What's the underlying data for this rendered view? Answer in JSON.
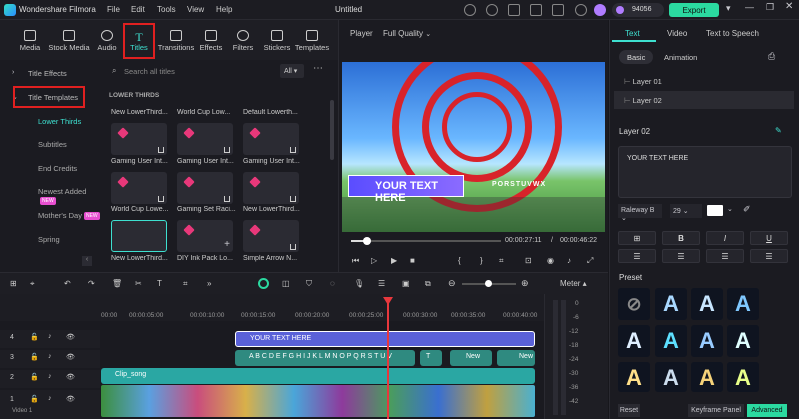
{
  "titlebar": {
    "app_name": "Wondershare Filmora",
    "menus": [
      "File",
      "Edit",
      "Tools",
      "View",
      "Help"
    ],
    "project_name": "Untitled",
    "credits": "94056",
    "export_label": "Export"
  },
  "media_tabs": [
    {
      "label": "Media",
      "icon": "media-icon"
    },
    {
      "label": "Stock Media",
      "icon": "stock-media-icon"
    },
    {
      "label": "Audio",
      "icon": "audio-icon"
    },
    {
      "label": "Titles",
      "icon": "titles-icon",
      "active": true
    },
    {
      "label": "Transitions",
      "icon": "transitions-icon"
    },
    {
      "label": "Effects",
      "icon": "effects-icon"
    },
    {
      "label": "Filters",
      "icon": "filters-icon"
    },
    {
      "label": "Stickers",
      "icon": "stickers-icon"
    },
    {
      "label": "Templates",
      "icon": "templates-icon"
    }
  ],
  "sidenav": {
    "items": [
      {
        "label": "Title Effects"
      },
      {
        "label": "Title Templates"
      }
    ],
    "subitems": [
      {
        "label": "Lower Thirds",
        "selected": true
      },
      {
        "label": "Subtitles"
      },
      {
        "label": "End Credits"
      },
      {
        "label": "Newest Added",
        "badge": "NEW"
      },
      {
        "label": "Mother's Day",
        "badge": "NEW"
      },
      {
        "label": "Spring"
      }
    ]
  },
  "browser": {
    "search_placeholder": "Search all titles",
    "filter": "All",
    "section": "LOWER THIRDS",
    "titles": [
      "New LowerThird...",
      "World Cup Low...",
      "Default Lowerth...",
      "Gaming User Int...",
      "Gaming User Int...",
      "Gaming User Int...",
      "World Cup Lowe...",
      "Gaming Set Raci...",
      "New LowerThird...",
      "New LowerThird...",
      "DIY Ink Pack Lo...",
      "Simple Arrow N..."
    ]
  },
  "player": {
    "label": "Player",
    "quality": "Full Quality",
    "overlay_text": "YOUR TEXT HERE",
    "overlay_sub": "PORSTUVWX",
    "current_time": "00:00:27:11",
    "total_time": "00:00:46:22"
  },
  "right_panel": {
    "tabs": [
      "Text",
      "Video",
      "Text to Speech"
    ],
    "subtabs": [
      "Basic",
      "Animation"
    ],
    "layers": [
      "Layer 01",
      "Layer 02"
    ],
    "layer_title": "Layer 02",
    "text_value": "YOUR TEXT HERE",
    "font": "Raleway B",
    "font_size": "29",
    "preset_label": "Preset",
    "reset_label": "Reset",
    "keyframe_label": "Keyframe Panel",
    "advanced_label": "Advanced"
  },
  "timeline": {
    "timecodes": [
      "00:00",
      "00:00:05:00",
      "00:00:10:00",
      "00:00:15:00",
      "00:00:20:00",
      "00:00:25:00",
      "00:00:30:00",
      "00:00:35:00",
      "00:00:40:00"
    ],
    "meter_label": "Meter",
    "meter_scale": [
      "0",
      "-6",
      "-12",
      "-18",
      "-24",
      "-30",
      "-36",
      "-42"
    ],
    "track_numbers": [
      "4",
      "3",
      "2",
      "1"
    ],
    "video_label": "Video 1",
    "clips": {
      "title1": "YOUR TEXT HERE",
      "title2": "A B C D E F G H I J K L M N O P Q R S T U V",
      "title3": "New",
      "title4": "New",
      "audio": "Clip_song",
      "t_label": "T"
    }
  }
}
